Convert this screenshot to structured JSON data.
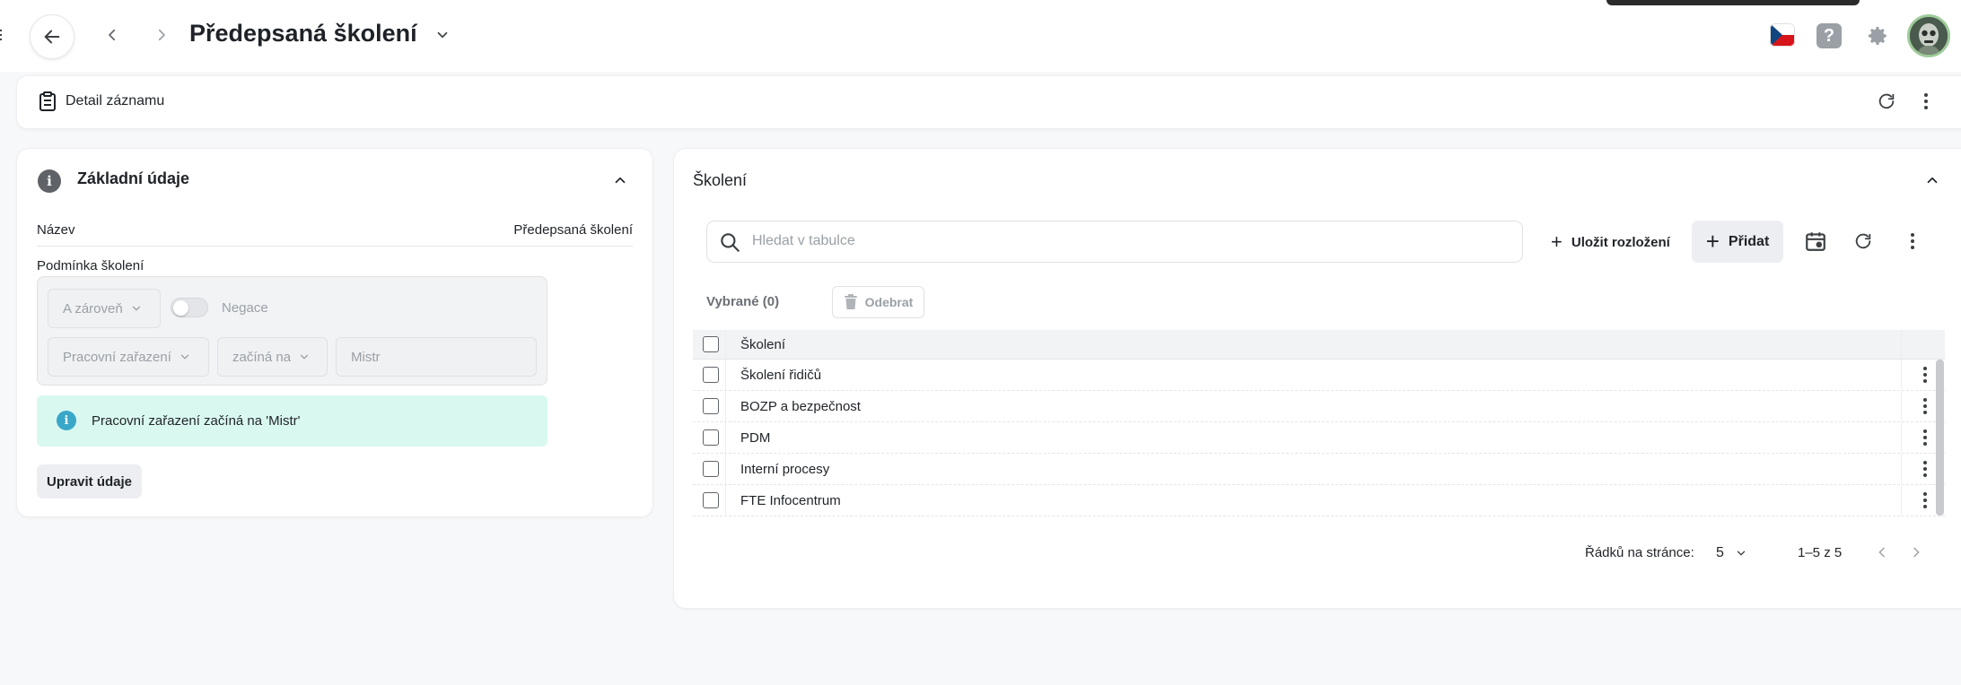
{
  "header": {
    "title": "Předepsaná školení",
    "help_label": "?"
  },
  "detail_bar": {
    "label": "Detail záznamu"
  },
  "basic_info": {
    "title": "Základní údaje",
    "info_glyph": "i",
    "name_label": "Název",
    "name_value": "Předepsaná školení",
    "condition_label": "Podmínka školení",
    "and_select": "A zároveň",
    "negation_label": "Negace",
    "negation_on": false,
    "role_select": "Pracovní zařazení",
    "operator_select": "začíná na",
    "value_input": "Mistr",
    "info_message": "Pracovní zařazení začíná na 'Mistr'",
    "edit_button": "Upravit údaje"
  },
  "trainings": {
    "title": "Školení",
    "search_placeholder": "Hledat v tabulce",
    "save_layout_label": "Uložit rozložení",
    "add_label": "Přidat",
    "selected_label": "Vybrané (0)",
    "remove_label": "Odebrat",
    "column_header": "Školení",
    "rows": [
      "Školení řidičů",
      "BOZP a bezpečnost",
      "PDM",
      "Interní procesy",
      "FTE Infocentrum"
    ],
    "rows_per_page_label": "Řádků na stránce:",
    "rows_per_page": "5",
    "range_label": "1–5 z 5"
  },
  "colors": {
    "accent_info": "#3aa7c9",
    "info_bg": "#d9f8f0",
    "flag_blue": "#11457e",
    "flag_red": "#d7141a"
  }
}
